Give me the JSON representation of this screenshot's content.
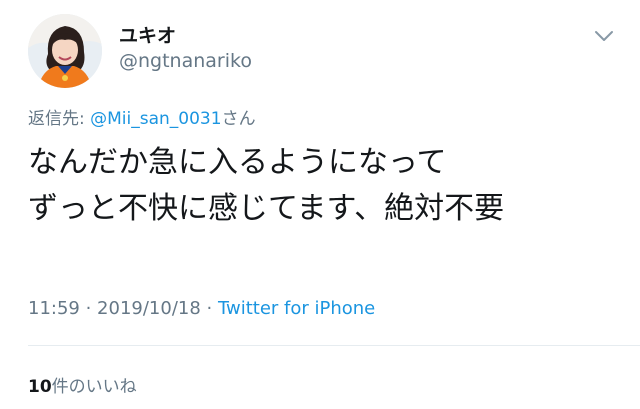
{
  "user": {
    "display_name": "ユキオ",
    "handle": "@ngtnanariko"
  },
  "reply": {
    "prefix": "返信先: ",
    "mention": "@Mii_san_0031",
    "suffix": "さん"
  },
  "tweet": {
    "lines": [
      "なんだか急に入るようになって",
      "ずっと不快に感じてます、絶対不要"
    ]
  },
  "meta": {
    "time": "11:59",
    "separator": " · ",
    "date": "2019/10/18",
    "source": "Twitter for iPhone"
  },
  "likes": {
    "count": "10",
    "label": "件のいいね"
  },
  "icons": {
    "menu": "chevron-down-icon",
    "avatar": "profile-photo"
  },
  "colors": {
    "text": "#14171a",
    "secondary": "#657786",
    "link": "#1b95e0",
    "divider": "#e6ecf0"
  }
}
